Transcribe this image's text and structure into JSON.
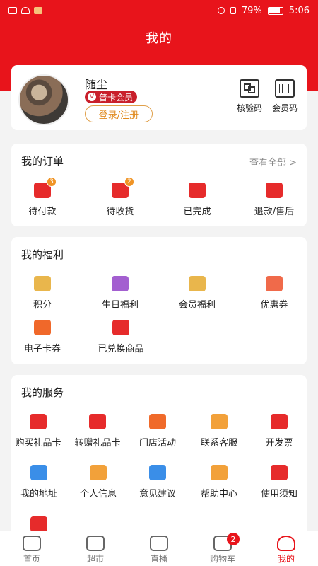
{
  "status_bar": {
    "battery": "79%",
    "time": "5:06"
  },
  "page_title": "我的",
  "profile": {
    "username": "随尘",
    "member_level": "普卡会员",
    "login_label": "登录/注册",
    "verify_code_label": "核验码",
    "member_code_label": "会员码"
  },
  "orders": {
    "title": "我的订单",
    "view_all": "查看全部 >",
    "items": [
      {
        "label": "待付款",
        "badge": "3",
        "icon": "wallet-icon"
      },
      {
        "label": "待收货",
        "badge": "2",
        "icon": "truck-icon"
      },
      {
        "label": "已完成",
        "icon": "chat-dots-icon"
      },
      {
        "label": "退款/售后",
        "icon": "refund-icon"
      }
    ]
  },
  "welfare": {
    "title": "我的福利",
    "items": [
      {
        "label": "积分",
        "icon": "coins-icon"
      },
      {
        "label": "生日福利",
        "icon": "cake-icon"
      },
      {
        "label": "会员福利",
        "icon": "crown-icon"
      },
      {
        "label": "优惠券",
        "icon": "coupon-icon"
      },
      {
        "label": "电子卡券",
        "icon": "e-card-icon"
      },
      {
        "label": "已兑换商品",
        "icon": "gift-icon"
      }
    ]
  },
  "services": {
    "title": "我的服务",
    "items": [
      {
        "label": "购买礼品卡",
        "icon": "gift-card-icon"
      },
      {
        "label": "转赠礼品卡",
        "icon": "gift-card-transfer-icon"
      },
      {
        "label": "门店活动",
        "icon": "store-activity-icon"
      },
      {
        "label": "联系客服",
        "icon": "phone-icon"
      },
      {
        "label": "开发票",
        "icon": "invoice-icon"
      },
      {
        "label": "我的地址",
        "icon": "location-icon"
      },
      {
        "label": "个人信息",
        "icon": "info-icon"
      },
      {
        "label": "意见建议",
        "icon": "feedback-icon"
      },
      {
        "label": "帮助中心",
        "icon": "help-icon"
      },
      {
        "label": "使用须知",
        "icon": "notice-icon"
      }
    ]
  },
  "bottom_nav": {
    "items": [
      {
        "label": "首页",
        "icon": "home-icon"
      },
      {
        "label": "超市",
        "icon": "basket-icon"
      },
      {
        "label": "直播",
        "icon": "tv-icon"
      },
      {
        "label": "购物车",
        "icon": "cart-icon",
        "badge": "2"
      },
      {
        "label": "我的",
        "icon": "user-icon",
        "active": true
      }
    ]
  },
  "colors": {
    "brand_red": "#e8141b",
    "accent_orange": "#f2a13a"
  }
}
